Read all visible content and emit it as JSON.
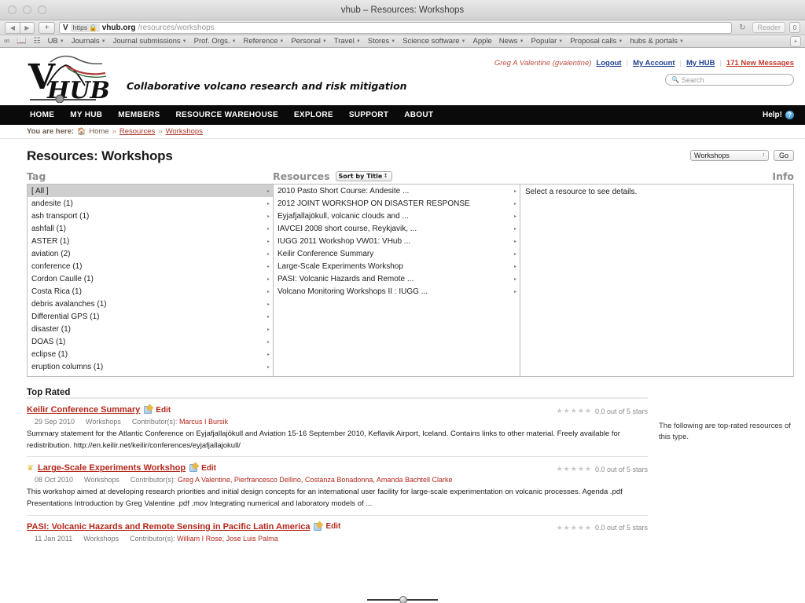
{
  "window": {
    "title": "vhub – Resources: Workshops"
  },
  "browser": {
    "back_icon": "◀",
    "forward_icon": "▶",
    "add_tab_icon": "+",
    "site_initial": "V",
    "https_label": "https",
    "lock_icon": "🔒",
    "url_host": "vhub.org",
    "url_path": "/resources/workshops",
    "reload_icon": "↻",
    "reader_label": "Reader",
    "downloads_icon": "0",
    "bookmarks": [
      {
        "label": "",
        "icon": "glasses-icon",
        "glyph": "∞"
      },
      {
        "label": "",
        "icon": "book-icon",
        "glyph": "▭"
      },
      {
        "label": "",
        "icon": "grid-icon",
        "glyph": "▦"
      },
      {
        "label": "UB",
        "icon": "",
        "caret": true
      },
      {
        "label": "Journals",
        "icon": "",
        "caret": true
      },
      {
        "label": "Journal submissions",
        "icon": "",
        "caret": true
      },
      {
        "label": "Prof. Orgs.",
        "icon": "",
        "caret": true
      },
      {
        "label": "Reference",
        "icon": "",
        "caret": true
      },
      {
        "label": "Personal",
        "icon": "",
        "caret": true
      },
      {
        "label": "Travel",
        "icon": "",
        "caret": true
      },
      {
        "label": "Stores",
        "icon": "",
        "caret": true
      },
      {
        "label": "Science software",
        "icon": "",
        "caret": true
      },
      {
        "label": "Apple",
        "icon": "",
        "caret": false
      },
      {
        "label": "News",
        "icon": "",
        "caret": true
      },
      {
        "label": "Popular",
        "icon": "",
        "caret": true
      },
      {
        "label": "Proposal calls",
        "icon": "",
        "caret": true
      },
      {
        "label": "hubs & portals",
        "icon": "",
        "caret": true
      }
    ],
    "bookmarks_add_icon": "+"
  },
  "site": {
    "logo_text_v": "V",
    "logo_text_hub": "HUB",
    "tagline": "Collaborative volcano research and risk mitigation",
    "user": {
      "name": "Greg A Valentine (gvalentine)",
      "logout": "Logout",
      "my_account": "My Account",
      "my_hub": "My HUB",
      "new_messages": "171 New Messages"
    },
    "search": {
      "placeholder": "Search",
      "icon": "search-icon"
    },
    "nav": [
      "HOME",
      "MY HUB",
      "MEMBERS",
      "RESOURCE WAREHOUSE",
      "EXPLORE",
      "SUPPORT",
      "ABOUT"
    ],
    "help_label": "Help!",
    "help_badge": "?"
  },
  "breadcrumb": {
    "prefix": "You are here:",
    "home": "Home",
    "sep": "»",
    "items": [
      "Resources",
      "Workshops"
    ]
  },
  "page": {
    "title": "Resources: Workshops",
    "type_filter": {
      "value": "Workshops",
      "go_label": "Go"
    }
  },
  "finder": {
    "headers": {
      "tag": "Tag",
      "resources": "Resources",
      "info": "Info"
    },
    "sort": {
      "value": "Sort by Title"
    },
    "tags": [
      {
        "label": "[ All ]",
        "selected": true
      },
      {
        "label": "andesite (1)",
        "selected": false
      },
      {
        "label": "ash transport (1)",
        "selected": false
      },
      {
        "label": "ashfall (1)",
        "selected": false
      },
      {
        "label": "ASTER (1)",
        "selected": false
      },
      {
        "label": "aviation (2)",
        "selected": false
      },
      {
        "label": "conference (1)",
        "selected": false
      },
      {
        "label": "Cordon Caulle (1)",
        "selected": false
      },
      {
        "label": "Costa Rica (1)",
        "selected": false
      },
      {
        "label": "debris avalanches (1)",
        "selected": false
      },
      {
        "label": "Differential GPS (1)",
        "selected": false
      },
      {
        "label": "disaster (1)",
        "selected": false
      },
      {
        "label": "DOAS (1)",
        "selected": false
      },
      {
        "label": "eclipse (1)",
        "selected": false
      },
      {
        "label": "eruption columns (1)",
        "selected": false
      }
    ],
    "resources": [
      "2010 Pasto Short Course: Andesite ...",
      "2012 JOINT WORKSHOP ON DISASTER RESPONSE",
      "Eyjafjallajökull, volcanic clouds and ...",
      "IAVCEI 2008 short course, Reykjavik, ...",
      "IUGG 2011 Workshop VW01: VHub ...",
      "Keilir Conference Summary",
      "Large-Scale Experiments Workshop",
      "PASI: Volcanic Hazards and Remote ...",
      "Volcano Monitoring Workshops II : IUGG ..."
    ],
    "info_placeholder": "Select a resource to see details.",
    "row_arrow": "▸"
  },
  "top_rated": {
    "heading": "Top Rated",
    "side_note": "The following are top-rated resources of this type.",
    "edit_label": "Edit",
    "contributors_label": "Contributor(s):",
    "stars_glyphs": "★★★★★",
    "items": [
      {
        "crown": false,
        "title": "Keilir Conference Summary",
        "date": "29 Sep 2010",
        "category": "Workshops",
        "contributors": "Marcus I Bursik",
        "description": "Summary statement for the Atlantic Conference on Eyjafjallajökull and Aviation 15-16 September 2010, Keflavik Airport, Iceland. Contains links to other material. Freely available for redistribution. http://en.keilir.net/keilir/conferences/eyjafjallajokull/",
        "rating_text": "0.0 out of 5 stars"
      },
      {
        "crown": true,
        "title": "Large-Scale Experiments Workshop",
        "date": "08 Oct 2010",
        "category": "Workshops",
        "contributors": "Greg A Valentine, Pierfrancesco Dellino, Costanza Bonadonna, Amanda Bachtell Clarke",
        "description": "This workshop aimed at developing research priorities and initial design concepts for an international user facility for large-scale experimentation on volcanic processes. Agenda .pdf Presentations Introduction by Greg Valentine .pdf .mov Integrating numerical and laboratory models of ...",
        "rating_text": "0.0 out of 5 stars"
      },
      {
        "crown": false,
        "title": "PASI: Volcanic Hazards and Remote Sensing in Pacific Latin America",
        "date": "11 Jan 2011",
        "category": "Workshops",
        "contributors": "William I Rose, Jose Luis Palma",
        "description": "",
        "rating_text": "0.0 out of 5 stars"
      }
    ]
  }
}
